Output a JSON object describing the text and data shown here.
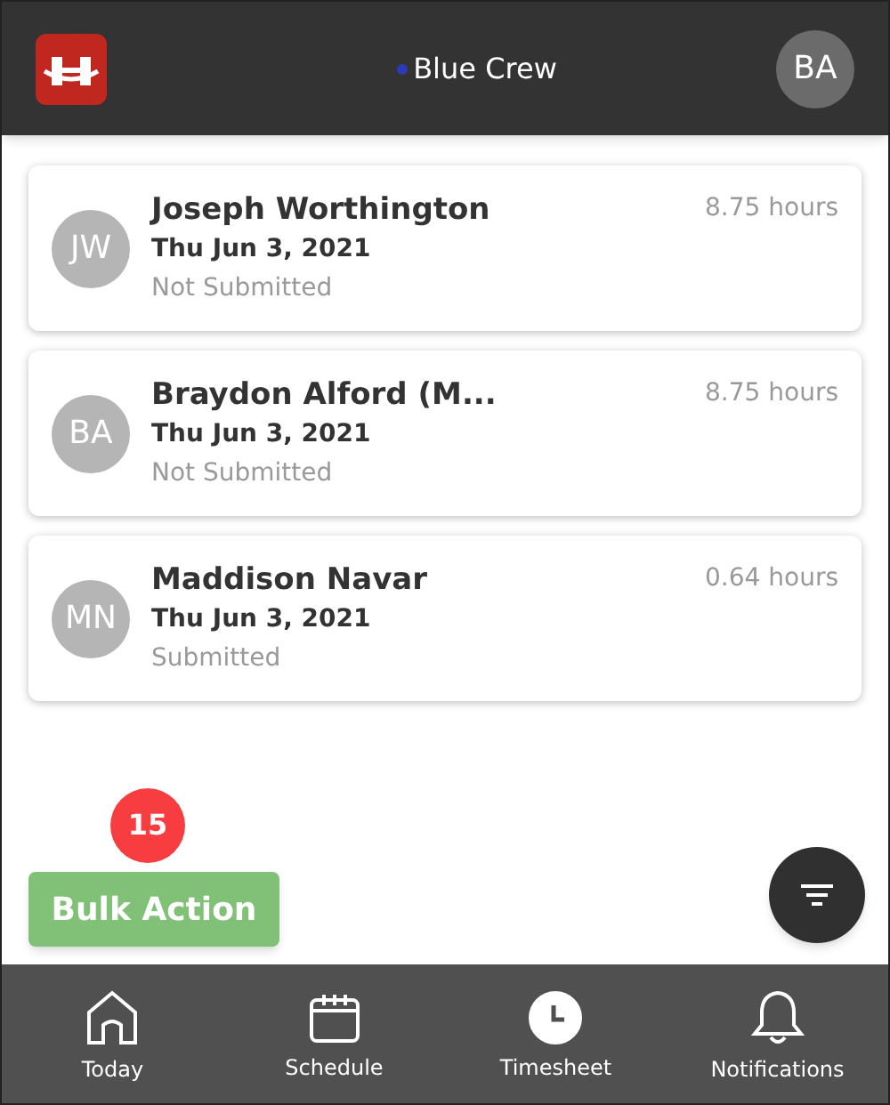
{
  "header": {
    "crew": {
      "name": "Blue Crew",
      "color": "#2b3bb8"
    },
    "user_initials": "BA"
  },
  "timesheets": [
    {
      "initials": "JW",
      "name": "Joseph Worthington",
      "date": "Thu Jun 3, 2021",
      "status": "Not Submitted",
      "hours": "8.75 hours"
    },
    {
      "initials": "BA",
      "name": "Braydon Alford (M...",
      "date": "Thu Jun 3, 2021",
      "status": "Not Submitted",
      "hours": "8.75 hours"
    },
    {
      "initials": "MN",
      "name": "Maddison Navar",
      "date": "Thu Jun 3, 2021",
      "status": "Submitted",
      "hours": "0.64 hours"
    }
  ],
  "bulk_action": {
    "label": "Bulk Action",
    "count": "15"
  },
  "nav": [
    {
      "kind": "home",
      "label": "Today",
      "selected": false
    },
    {
      "kind": "calendar",
      "label": "Schedule",
      "selected": false
    },
    {
      "kind": "clock",
      "label": "Timesheet",
      "selected": true
    },
    {
      "kind": "bell",
      "label": "Notifications",
      "selected": false
    }
  ]
}
